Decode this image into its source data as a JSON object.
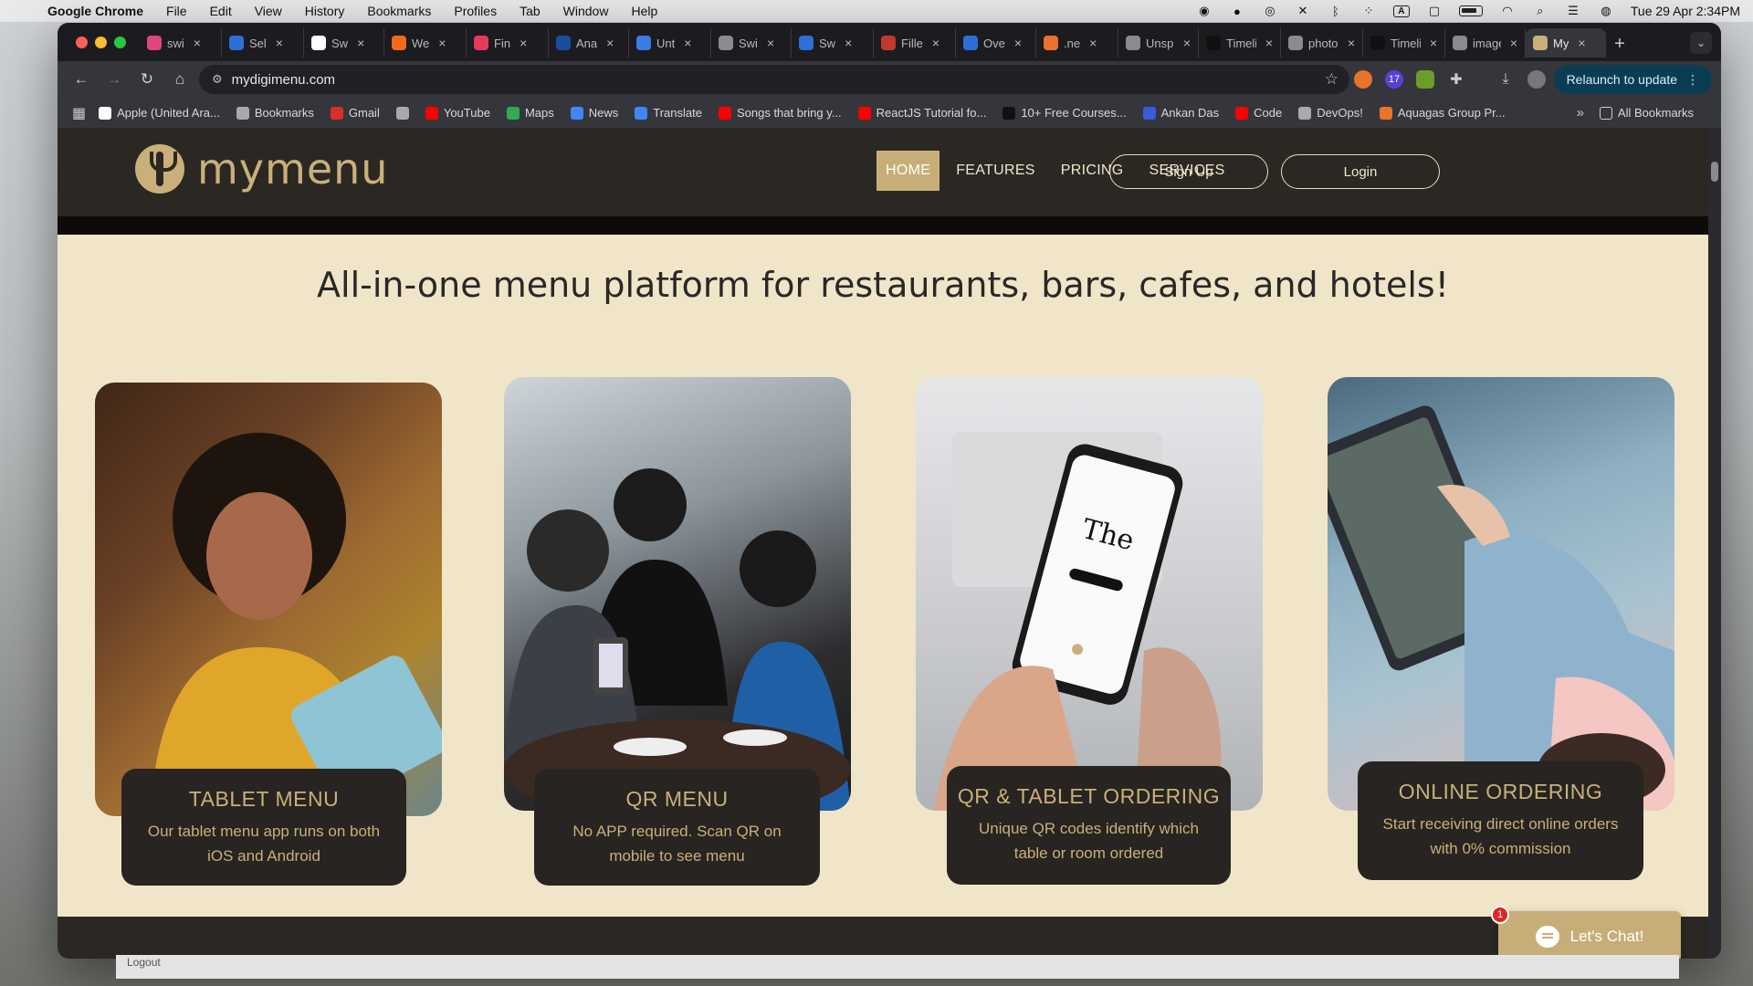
{
  "menubar": {
    "app_name": "Google Chrome",
    "items": [
      "File",
      "Edit",
      "View",
      "History",
      "Bookmarks",
      "Profiles",
      "Tab",
      "Window",
      "Help"
    ],
    "datetime": "Tue 29 Apr  2:34PM",
    "input_source": "A"
  },
  "tabs": [
    {
      "label": "swi",
      "color": "#e0457b"
    },
    {
      "label": "Sel",
      "color": "#2d6fd6"
    },
    {
      "label": "Sw",
      "color": "#ffffff"
    },
    {
      "label": "We",
      "color": "#f26b1d"
    },
    {
      "label": "Fin",
      "color": "#e53a5a"
    },
    {
      "label": "Ana",
      "color": "#1a4d9c"
    },
    {
      "label": "Unt",
      "color": "#3b7ce8"
    },
    {
      "label": "Swi",
      "color": "#8a8a8f"
    },
    {
      "label": "Sw",
      "color": "#2d6fd6"
    },
    {
      "label": "Fille",
      "color": "#c0392b"
    },
    {
      "label": "Ove",
      "color": "#2d6fd6"
    },
    {
      "label": ".ne",
      "color": "#e8732a"
    },
    {
      "label": "Unspla",
      "color": "#8a8a8f"
    },
    {
      "label": "Timelin",
      "color": "#111111"
    },
    {
      "label": "photo-",
      "color": "#8a8a8f"
    },
    {
      "label": "Timelin",
      "color": "#111111"
    },
    {
      "label": "images",
      "color": "#8a8a8f"
    },
    {
      "label": "My",
      "color": "#c9b07a",
      "active": true
    }
  ],
  "toolbar": {
    "url": "mydigimenu.com",
    "relaunch_label": "Relaunch to update",
    "ext_badge": "17"
  },
  "bookmarks": [
    {
      "label": "Apple (United Ara...",
      "color": "#ffffff"
    },
    {
      "label": "Bookmarks",
      "color": "#aaaaaa"
    },
    {
      "label": "Gmail",
      "color": "#d93025"
    },
    {
      "label": "",
      "color": "#aaaaaa"
    },
    {
      "label": "YouTube",
      "color": "#ff0000"
    },
    {
      "label": "Maps",
      "color": "#34a853"
    },
    {
      "label": "News",
      "color": "#4285f4"
    },
    {
      "label": "Translate",
      "color": "#4285f4"
    },
    {
      "label": "Songs that bring y...",
      "color": "#ff0000"
    },
    {
      "label": "ReactJS Tutorial fo...",
      "color": "#ff0000"
    },
    {
      "label": "10+ Free Courses...",
      "color": "#111111"
    },
    {
      "label": "Ankan Das",
      "color": "#3b5bdb"
    },
    {
      "label": "Code",
      "color": "#ff0000"
    },
    {
      "label": "DevOps!",
      "color": "#aaaaaa"
    },
    {
      "label": "Aquagas Group Pr...",
      "color": "#e8732a"
    }
  ],
  "bookmarks_all": "All Bookmarks",
  "site": {
    "brand": "mymenu",
    "nav": [
      "HOME",
      "FEATURES",
      "PRICING",
      "SERVICES"
    ],
    "signup": "Sign Up",
    "login": "Login",
    "headline": "All-in-one menu platform for restaurants, bars, cafes, and hotels!",
    "accent": "#c7ae78",
    "dark": "#2b2823",
    "background": "#f1e5c9",
    "cards": [
      {
        "title": "TABLET MENU",
        "desc": "Our tablet menu app runs on both iOS and Android",
        "photo": "woman-with-tablet"
      },
      {
        "title": "QR MENU",
        "desc": "No APP required. Scan QR on mobile to see menu",
        "photo": "waitress-showing-qr"
      },
      {
        "title": "QR & TABLET ORDERING",
        "desc": "Unique QR codes identify which table or room ordered",
        "photo": "hands-with-phone"
      },
      {
        "title": "ONLINE ORDERING",
        "desc": "Start receiving direct online orders with 0% commission",
        "photo": "person-with-tablet"
      }
    ],
    "chat_label": "Let's Chat!",
    "chat_badge": "1"
  },
  "behind_window_text": "Logout"
}
